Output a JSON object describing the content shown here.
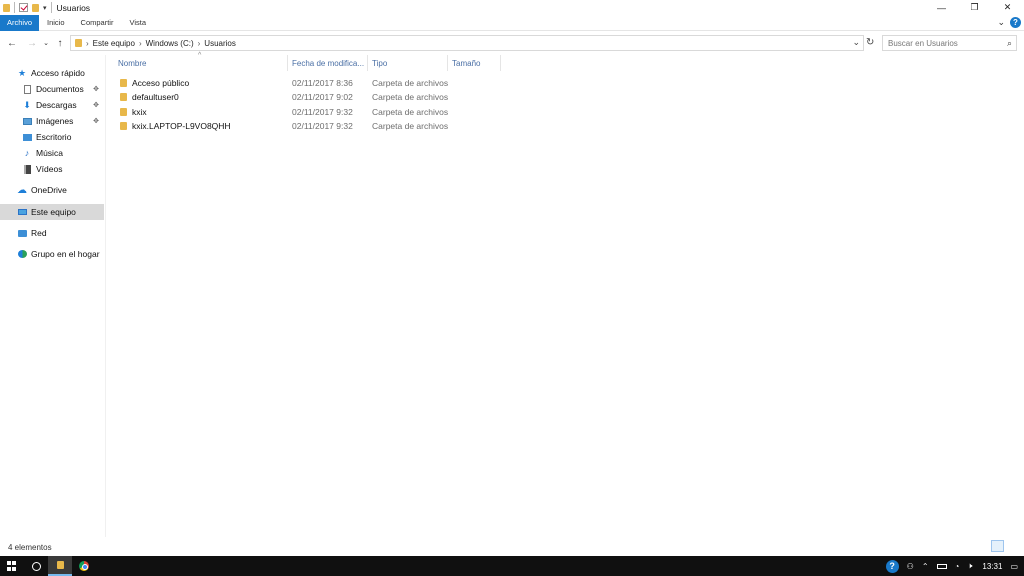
{
  "window": {
    "title": "Usuarios",
    "controls": {
      "minimize": "—",
      "maximize": "❐",
      "close": "✕"
    }
  },
  "ribbon": {
    "tabs": [
      {
        "label": "Archivo",
        "active": true
      },
      {
        "label": "Inicio"
      },
      {
        "label": "Compartir"
      },
      {
        "label": "Vista"
      }
    ],
    "expand": "⌄",
    "help": "?"
  },
  "address": {
    "back": "←",
    "forward": "→",
    "recent": "⌄",
    "up": "↑",
    "path": [
      "Este equipo",
      "Windows (C:)",
      "Usuarios"
    ],
    "dropdown": "⌄",
    "refresh": "↻",
    "search_placeholder": "Buscar en Usuarios"
  },
  "sidebar": {
    "items": [
      {
        "label": "Acceso rápido",
        "icon": "star-icon",
        "glyph": "★",
        "color": "#1e7fd8"
      },
      {
        "label": "Documentos",
        "icon": "documents-icon",
        "pinned": true
      },
      {
        "label": "Descargas",
        "icon": "downloads-icon",
        "pinned": true
      },
      {
        "label": "Imágenes",
        "icon": "pictures-icon",
        "pinned": true
      },
      {
        "label": "Escritorio",
        "icon": "desktop-icon"
      },
      {
        "label": "Música",
        "icon": "music-icon"
      },
      {
        "label": "Vídeos",
        "icon": "videos-icon"
      },
      {
        "label": "OneDrive",
        "icon": "onedrive-icon"
      },
      {
        "label": "Este equipo",
        "icon": "this-pc-icon",
        "selected": true
      },
      {
        "label": "Red",
        "icon": "network-icon"
      },
      {
        "label": "Grupo en el hogar",
        "icon": "homegroup-icon"
      }
    ],
    "pin_glyph": "📌"
  },
  "columns": {
    "name": "Nombre",
    "date": "Fecha de modifica...",
    "type": "Tipo",
    "size": "Tamaño"
  },
  "files": [
    {
      "name": "Acceso público",
      "date": "02/11/2017 8:36",
      "type": "Carpeta de archivos"
    },
    {
      "name": "defaultuser0",
      "date": "02/11/2017 9:02",
      "type": "Carpeta de archivos"
    },
    {
      "name": "kxix",
      "date": "02/11/2017 9:32",
      "type": "Carpeta de archivos"
    },
    {
      "name": "kxix.LAPTOP-L9VO8QHH",
      "date": "02/11/2017 9:32",
      "type": "Carpeta de archivos"
    }
  ],
  "status": {
    "count": "4 elementos"
  },
  "taskbar": {
    "clock": "13:31"
  },
  "colors": {
    "accent": "#1979ca",
    "folder": "#e8b84a",
    "selected": "#d9d9d9",
    "taskbar": "#101010"
  }
}
